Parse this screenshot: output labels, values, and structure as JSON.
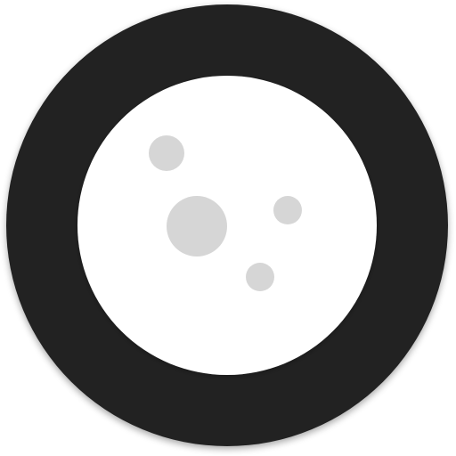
{
  "icon": {
    "name": "moon-icon",
    "colors": {
      "background": "#ffffff",
      "ring": "#222222",
      "moon_face": "#ffffff",
      "crater": "#d6d6d6",
      "shadow": "#000000"
    }
  }
}
